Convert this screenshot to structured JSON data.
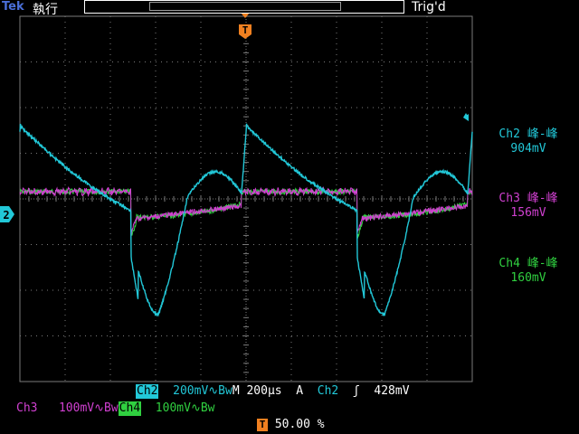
{
  "header": {
    "brand": "Tek",
    "run_state": "執行",
    "trig_status": "Trig'd"
  },
  "measurements": [
    {
      "label": "Ch2 峰-峰",
      "value": "904mV",
      "color": "#22c8d8"
    },
    {
      "label": "Ch3 峰-峰",
      "value": "156mV",
      "color": "#d040d0"
    },
    {
      "label": "Ch4 峰-峰",
      "value": "160mV",
      "color": "#30d040"
    }
  ],
  "footer": {
    "ch2": {
      "name": "Ch2",
      "scale": "200mV",
      "coupling": "∿Bw"
    },
    "horizontal": {
      "prefix": "M",
      "timebase": "200µs"
    },
    "trigger": {
      "mode": "A",
      "source": "Ch2",
      "slope": "ʃ",
      "level": "428mV"
    },
    "ch3": {
      "name": "Ch3",
      "scale": "100mV",
      "coupling": "∿Bw"
    },
    "ch4": {
      "name": "Ch4",
      "scale": "100mV",
      "coupling": "∿Bw"
    },
    "trigger_position": {
      "marker": "T",
      "value": "50.00 %"
    }
  },
  "markers": {
    "trigger_marker": "T",
    "ch2_ground": "2"
  },
  "colors": {
    "ch2": "#22c8d8",
    "ch3": "#d040d0",
    "ch4": "#30d040",
    "trigger": "#f08020",
    "grid": "#7a7a7a"
  }
}
